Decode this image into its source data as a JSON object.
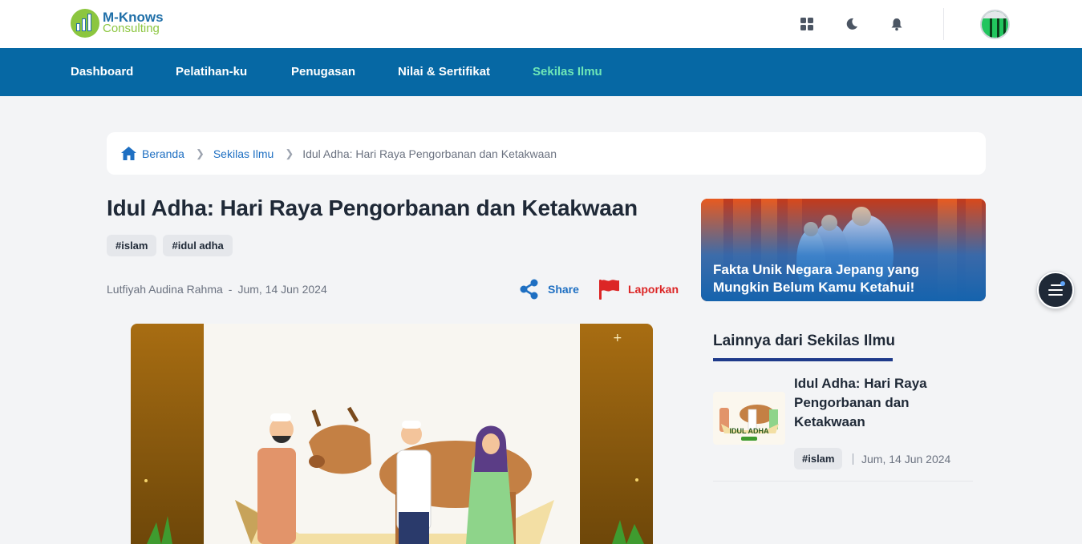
{
  "header": {
    "logo_line1": "M-Knows",
    "logo_line2": "Consulting",
    "icons": [
      "apps-grid-icon",
      "moon-icon",
      "bell-icon"
    ]
  },
  "nav": {
    "items": [
      {
        "label": "Dashboard"
      },
      {
        "label": "Pelatihan-ku"
      },
      {
        "label": "Penugasan"
      },
      {
        "label": "Nilai & Sertifikat"
      },
      {
        "label": "Sekilas Ilmu",
        "active": true
      }
    ]
  },
  "breadcrumb": {
    "home": "Beranda",
    "section": "Sekilas Ilmu",
    "current": "Idul Adha: Hari Raya Pengorbanan dan Ketakwaan"
  },
  "article": {
    "title": "Idul Adha: Hari Raya Pengorbanan dan Ketakwaan",
    "tags": [
      "#islam",
      "#idul adha"
    ],
    "author": "Lutfiyah Audina Rahma",
    "separator": "-",
    "date": "Jum, 14 Jun 2024",
    "share_label": "Share",
    "report_label": "Laporkan"
  },
  "sidebar": {
    "banner_line1": "Fakta Unik Negara Jepang yang",
    "banner_line2": "Mungkin Belum Kamu Ketahui!",
    "section_title": "Lainnya dari Sekilas Ilmu",
    "cards": [
      {
        "title": "Idul Adha: Hari Raya Pengorbanan dan Ketakwaan",
        "tag": "#islam",
        "date": "Jum, 14 Jun 2024",
        "thumb_text": "IDUL ADHA"
      }
    ]
  },
  "colors": {
    "nav_bg": "#0668a4",
    "nav_active": "#6ee7b7",
    "link": "#1e6fc2",
    "report": "#dc2626",
    "underline": "#1e3a8a"
  }
}
